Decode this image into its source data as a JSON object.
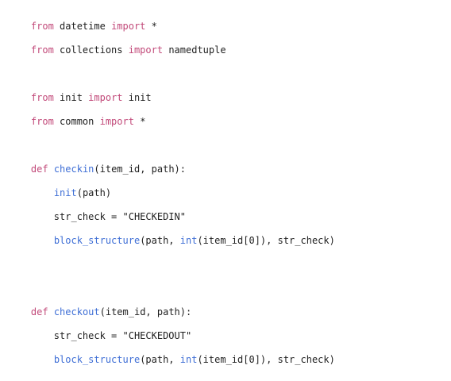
{
  "code": {
    "language": "python",
    "line_1": [
      "from",
      " datetime ",
      "import",
      " *"
    ],
    "line_2": [
      "from",
      " collections ",
      "import",
      " namedtuple"
    ],
    "line_3": [],
    "line_4": [
      "from",
      " init ",
      "import",
      " init"
    ],
    "line_5": [
      "from",
      " common ",
      "import",
      " *"
    ],
    "line_6": [],
    "line_7": [
      "def",
      " ",
      "checkin",
      "(item_id, path):"
    ],
    "line_8": [
      "    ",
      "init",
      "(path)"
    ],
    "line_9": [
      "    str_check = ",
      "\"CHECKEDIN\""
    ],
    "line_10": [
      "    ",
      "block_structure",
      "(path, ",
      "int",
      "(item_id[0]), str_check)"
    ],
    "line_11": [],
    "line_12": [],
    "line_13": [
      "def",
      " ",
      "checkout",
      "(item_id, path):"
    ],
    "line_14": [
      "    str_check = ",
      "\"CHECKEDOUT\""
    ],
    "line_15": [
      "    ",
      "block_structure",
      "(path, ",
      "int",
      "(item_id[0]), str_check)"
    ]
  },
  "colors": {
    "keyword": "#c24a7a",
    "function": "#3f6fd6",
    "text": "#1f1f1f",
    "background": "#ffffff"
  }
}
